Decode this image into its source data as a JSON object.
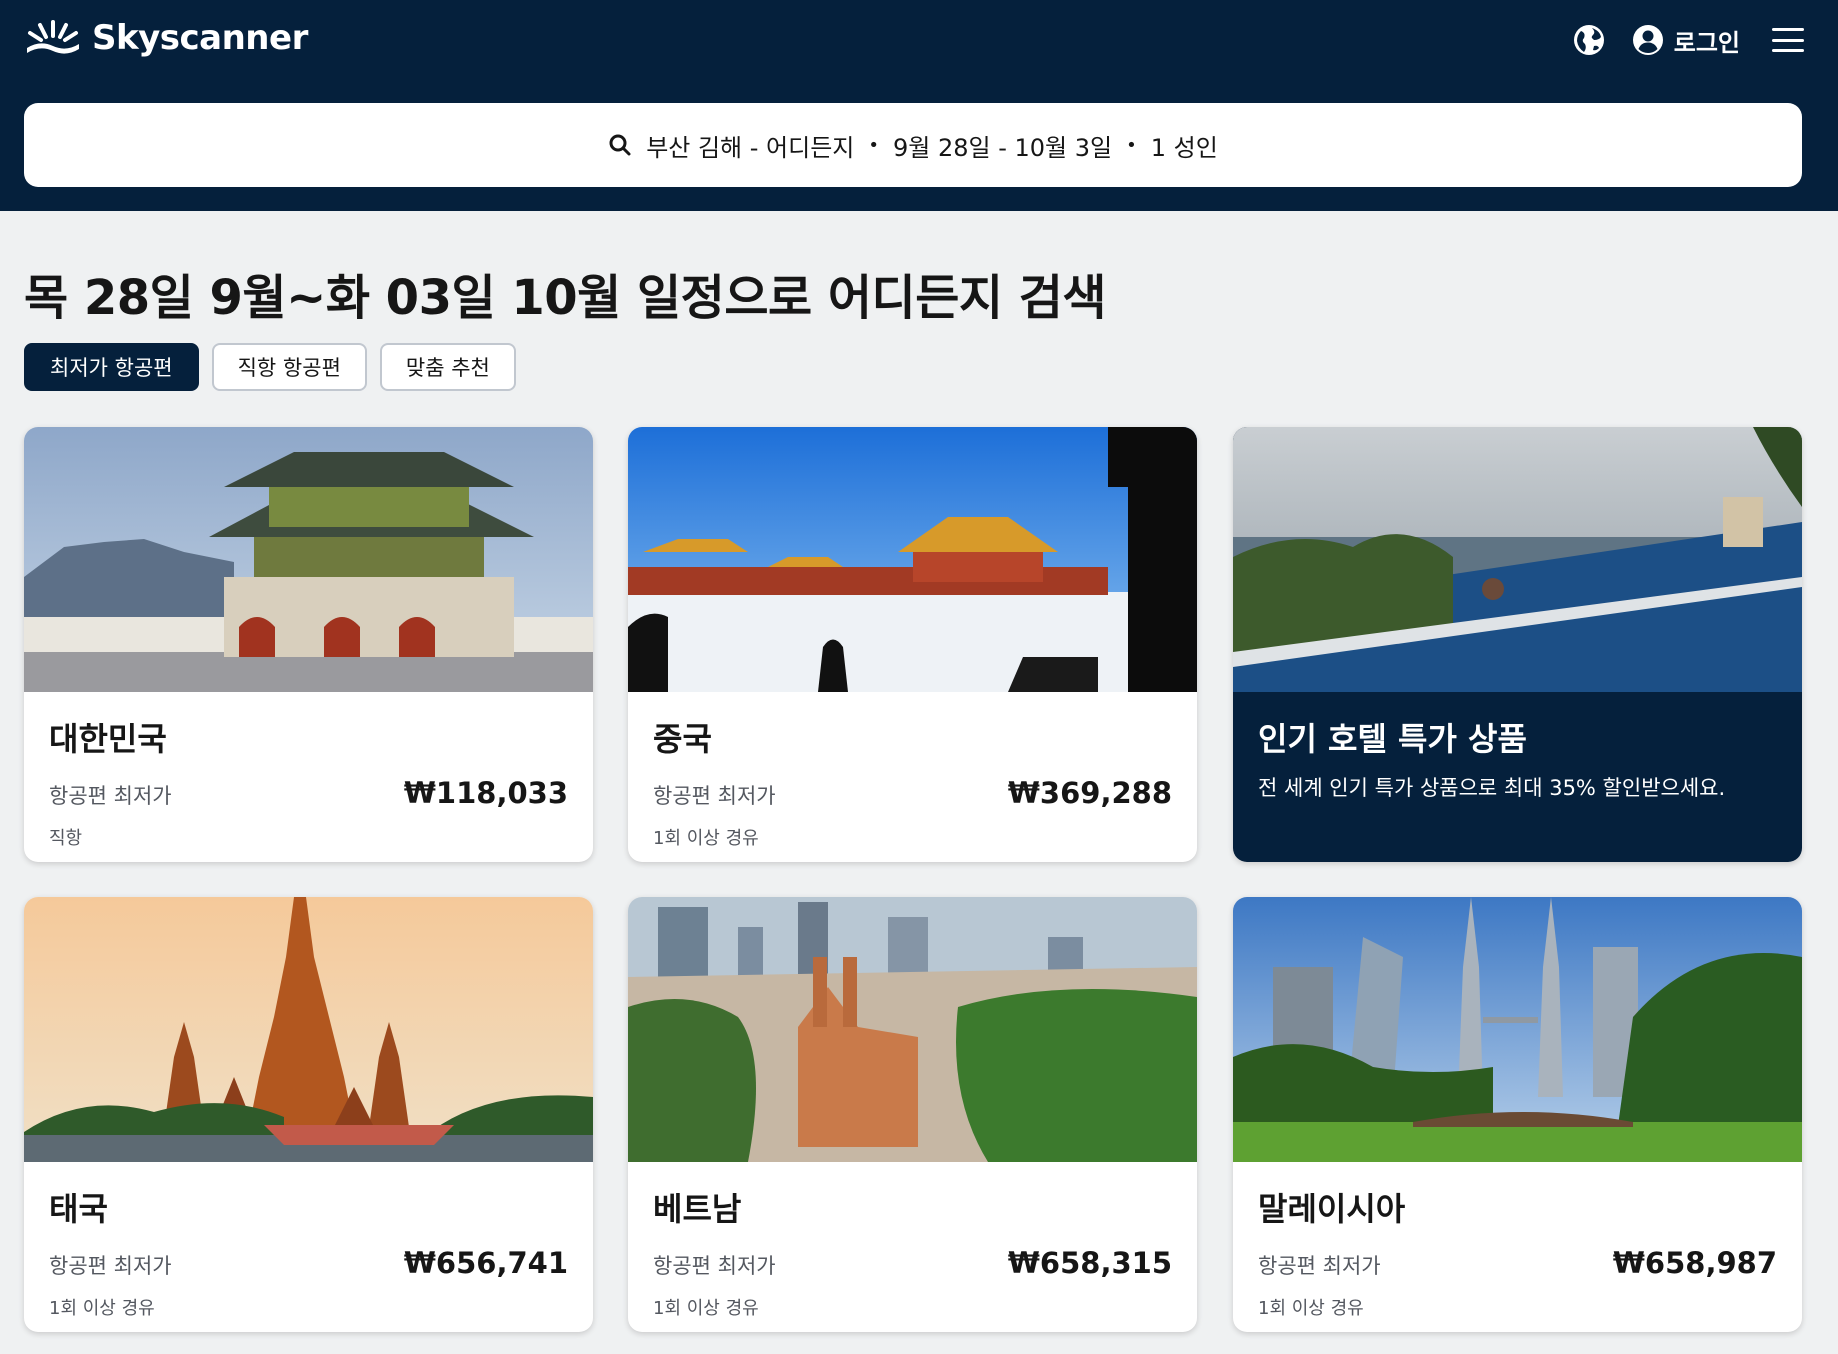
{
  "brand": {
    "name": "Skyscanner"
  },
  "header": {
    "login_label": "로그인"
  },
  "search": {
    "route": "부산 김해 - 어디든지",
    "dates": "9월 28일 - 10월 3일",
    "travellers": "1 성인",
    "separator": "•"
  },
  "page": {
    "title": "목 28일 9월~화 03일 10월 일정으로 어디든지 검색"
  },
  "tabs": [
    {
      "label": "최저가 항공편",
      "active": true
    },
    {
      "label": "직항 항공편",
      "active": false
    },
    {
      "label": "맞춤 추천",
      "active": false
    }
  ],
  "cards": [
    {
      "name": "대한민국",
      "price_label": "항공편 최저가",
      "price": "₩118,033",
      "stops": "직항"
    },
    {
      "name": "중국",
      "price_label": "항공편 최저가",
      "price": "₩369,288",
      "stops": "1회 이상 경유"
    },
    {
      "name": "태국",
      "price_label": "항공편 최저가",
      "price": "₩656,741",
      "stops": "1회 이상 경유"
    },
    {
      "name": "베트남",
      "price_label": "항공편 최저가",
      "price": "₩658,315",
      "stops": "1회 이상 경유"
    },
    {
      "name": "말레이시아",
      "price_label": "항공편 최저가",
      "price": "₩658,987",
      "stops": "1회 이상 경유"
    }
  ],
  "promo": {
    "title": "인기 호텔 특가 상품",
    "subtitle": "전 세계 인기 특가 상품으로 최대 35% 할인받으세요."
  },
  "colors": {
    "header_bg": "#05203c",
    "page_bg": "#eff1f2",
    "text": "#161616",
    "muted": "#545860"
  },
  "icons": [
    "skyscanner-logo-icon",
    "globe-icon",
    "account-icon",
    "menu-icon",
    "search-icon"
  ]
}
